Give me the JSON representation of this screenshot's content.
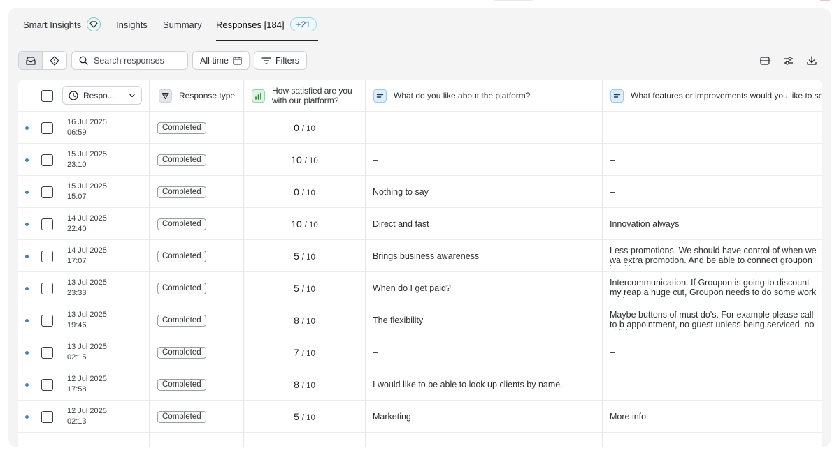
{
  "tabs": {
    "smart_insights": "Smart Insights",
    "insights": "Insights",
    "summary": "Summary",
    "responses": "Responses [184]",
    "responses_badge": "+21"
  },
  "toolbar": {
    "search_placeholder": "Search responses",
    "all_time": "All time",
    "filters": "Filters"
  },
  "columns": {
    "sort_label": "Respo...",
    "response_type": "Response type",
    "satisfaction_line1": "How satisfied are you",
    "satisfaction_line2": "with our platform?",
    "like": "What do you like about the platform?",
    "improve": "What features or improvements would you like to see i"
  },
  "score_denominator": "/ 10",
  "rows": [
    {
      "date": "16 Jul 2025",
      "time": "06:59",
      "status": "Completed",
      "score": "0",
      "like": "–",
      "improve": "–"
    },
    {
      "date": "15 Jul 2025",
      "time": "23:10",
      "status": "Completed",
      "score": "10",
      "like": "–",
      "improve": "–"
    },
    {
      "date": "15 Jul 2025",
      "time": "15:07",
      "status": "Completed",
      "score": "0",
      "like": "Nothing to say",
      "improve": "–"
    },
    {
      "date": "14 Jul 2025",
      "time": "22:40",
      "status": "Completed",
      "score": "10",
      "like": "Direct and fast",
      "improve": "Innovation always"
    },
    {
      "date": "14 Jul 2025",
      "time": "17:07",
      "status": "Completed",
      "score": "5",
      "like": "Brings business awareness",
      "improve": "Less promotions. We should have control of when we wa extra promotion. And be able to connect groupon bookin"
    },
    {
      "date": "13 Jul 2025",
      "time": "23:33",
      "status": "Completed",
      "score": "5",
      "like": "When do I get paid?",
      "improve": "Intercommunication. If Groupon is going to discount my reap a huge cut, Groupon needs to do some work and no"
    },
    {
      "date": "13 Jul 2025",
      "time": "19:46",
      "status": "Completed",
      "score": "8",
      "like": "The flexibility",
      "improve": "Maybe buttons of must do's. For example please call to b appointment, no guest unless being serviced, no childre"
    },
    {
      "date": "13 Jul 2025",
      "time": "02:15",
      "status": "Completed",
      "score": "7",
      "like": "–",
      "improve": "–"
    },
    {
      "date": "12 Jul 2025",
      "time": "17:58",
      "status": "Completed",
      "score": "8",
      "like": "I would like to be able to look up clients by name.",
      "improve": "–"
    },
    {
      "date": "12 Jul 2025",
      "time": "02:13",
      "status": "Completed",
      "score": "5",
      "like": "Marketing",
      "improve": "More info"
    }
  ]
}
